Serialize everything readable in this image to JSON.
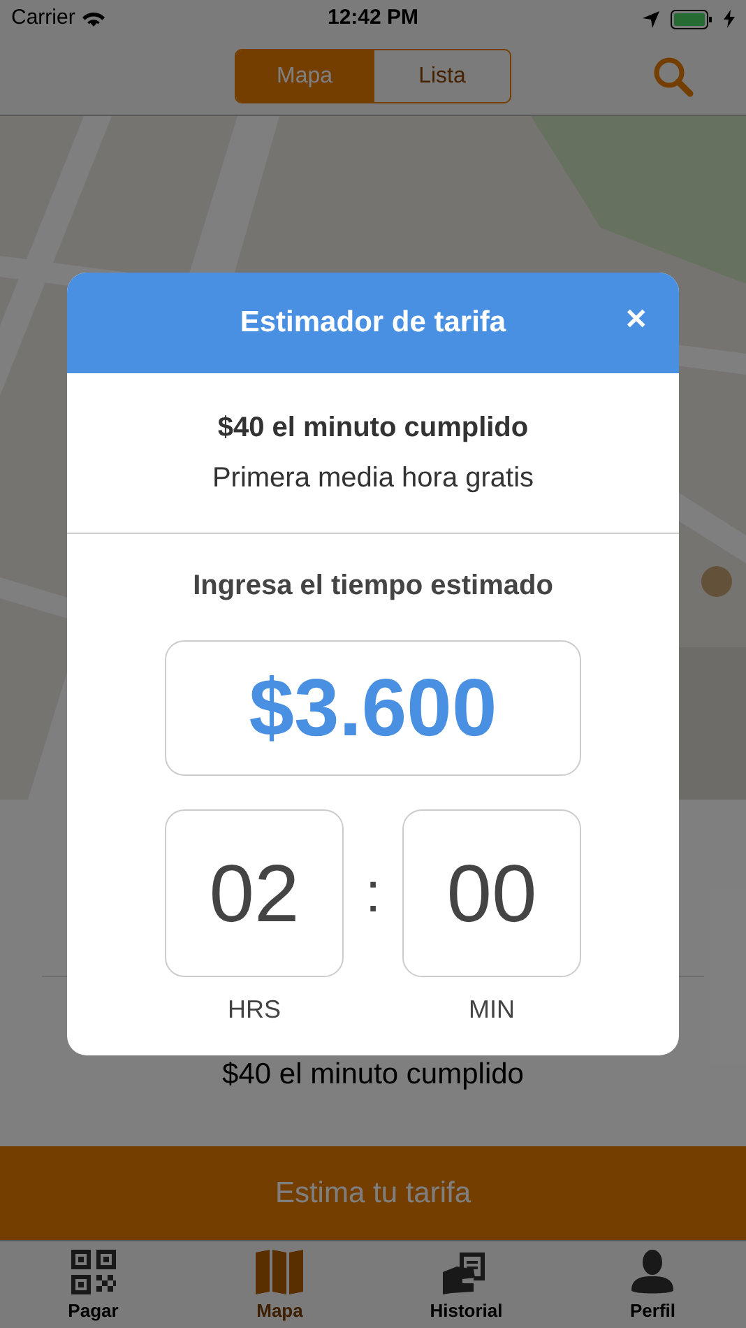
{
  "status_bar": {
    "carrier": "Carrier",
    "time": "12:42 PM"
  },
  "nav": {
    "segments": [
      {
        "label": "Mapa",
        "selected": true
      },
      {
        "label": "Lista",
        "selected": false
      }
    ]
  },
  "card": {
    "text": "$40 el minuto cumplido"
  },
  "action_button": {
    "label": "Estima tu tarifa"
  },
  "tabs": [
    {
      "label": "Pagar",
      "kind": "qr",
      "selected": false
    },
    {
      "label": "Mapa",
      "kind": "map",
      "selected": true
    },
    {
      "label": "Historial",
      "kind": "history",
      "selected": false
    },
    {
      "label": "Perfil",
      "kind": "profile",
      "selected": false
    }
  ],
  "modal": {
    "title": "Estimador de tarifa",
    "close": "✕",
    "rate": "$40 el minuto cumplido",
    "note": "Primera media hora gratis",
    "prompt": "Ingresa el tiempo estimado",
    "amount": "$3.600",
    "hours": "02",
    "separator": ":",
    "minutes": "00",
    "hours_label": "HRS",
    "minutes_label": "MIN"
  }
}
